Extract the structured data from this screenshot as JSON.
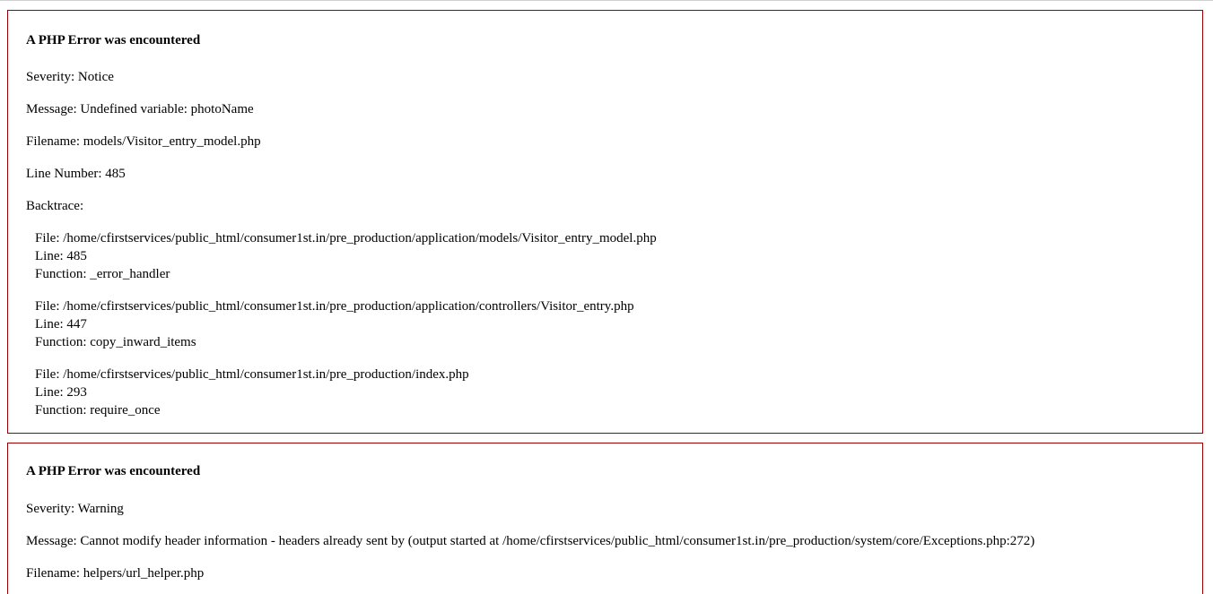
{
  "errors": [
    {
      "heading": "A PHP Error was encountered",
      "severity": "Severity: Notice",
      "message": "Message: Undefined variable: photoName",
      "filename": "Filename: models/Visitor_entry_model.php",
      "line_number": "Line Number: 485",
      "backtrace_label": "Backtrace:",
      "backtrace": [
        {
          "file": "File: /home/cfirstservices/public_html/consumer1st.in/pre_production/application/models/Visitor_entry_model.php",
          "line": "Line: 485",
          "function": "Function: _error_handler"
        },
        {
          "file": "File: /home/cfirstservices/public_html/consumer1st.in/pre_production/application/controllers/Visitor_entry.php",
          "line": "Line: 447",
          "function": "Function: copy_inward_items"
        },
        {
          "file": "File: /home/cfirstservices/public_html/consumer1st.in/pre_production/index.php",
          "line": "Line: 293",
          "function": "Function: require_once"
        }
      ]
    },
    {
      "heading": "A PHP Error was encountered",
      "severity": "Severity: Warning",
      "message": "Message: Cannot modify header information - headers already sent by (output started at /home/cfirstservices/public_html/consumer1st.in/pre_production/system/core/Exceptions.php:272)",
      "filename": "Filename: helpers/url_helper.php"
    }
  ],
  "colors": {
    "border": "#990000",
    "text": "#000000",
    "background": "#ffffff"
  }
}
